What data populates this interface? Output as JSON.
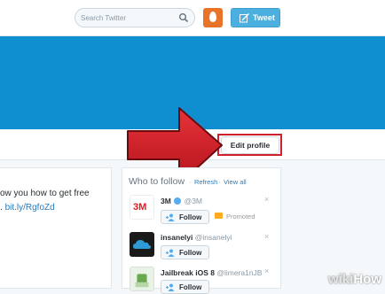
{
  "header": {
    "search_placeholder": "Search Twitter",
    "tweet_button_label": "Tweet"
  },
  "profile": {
    "edit_profile_label": "Edit profile"
  },
  "tweet_preview": {
    "line1": "ow you how to get free",
    "line2_prefix": ". ",
    "line2_link": "bit.ly/RgfoZd"
  },
  "who_to_follow": {
    "title": "Who to follow",
    "separator": "·",
    "refresh_label": "Refresh",
    "view_all_label": "View all",
    "suggestions": [
      {
        "logo_text": "3M",
        "name": "3M",
        "handle": "@3M",
        "follow_label": "Follow",
        "promoted_label": "Promoted",
        "verified": true
      },
      {
        "name": "insanelyi",
        "handle": "@insanelyi",
        "follow_label": "Follow"
      },
      {
        "name": "Jailbreak iOS 8",
        "handle": "@limera1nJB",
        "follow_label": "Follow"
      }
    ],
    "close_glyph": "×"
  },
  "watermark": {
    "wiki": "wiki",
    "how": "How"
  },
  "colors": {
    "banner": "#0f8fd0",
    "accent": "#4bb0e0",
    "highlight": "#d0202b",
    "arrow": "#d8232a"
  },
  "icons": [
    "search-icon",
    "egg-avatar",
    "compose-icon",
    "arrow-annotation",
    "follow-icon",
    "close-icon",
    "verified-icon"
  ]
}
